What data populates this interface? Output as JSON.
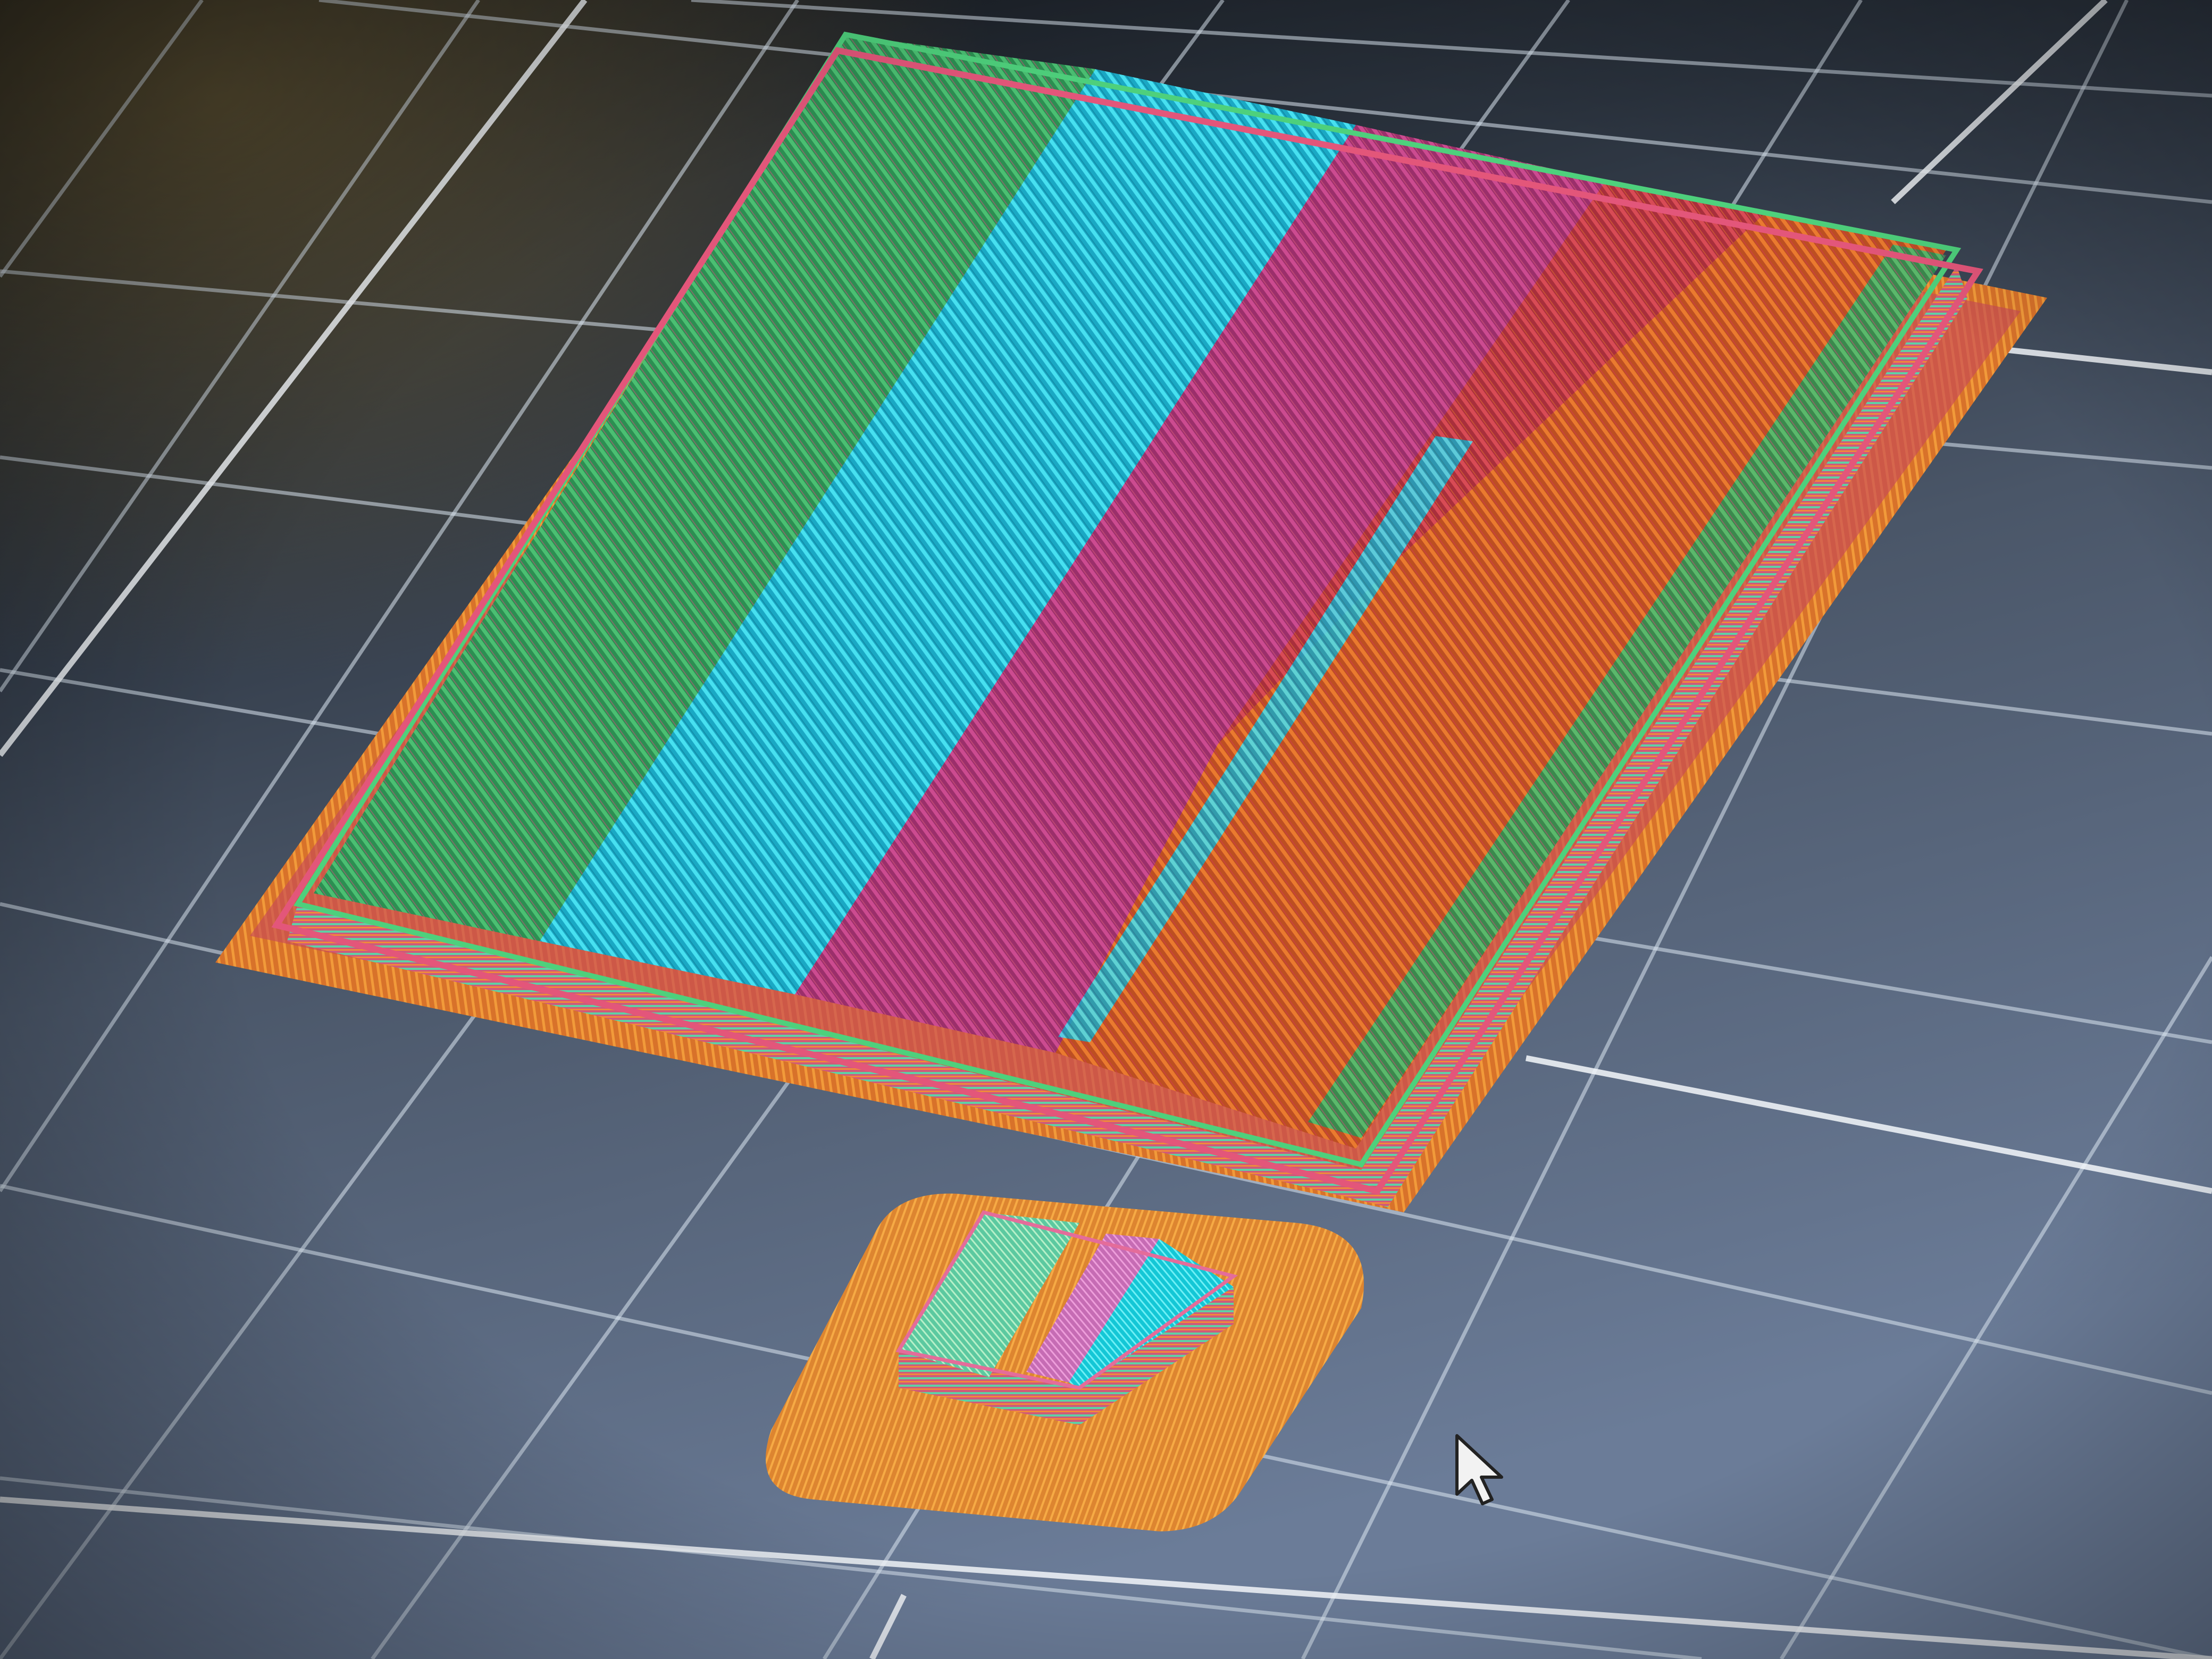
{
  "viewer": {
    "background_top": "#161a1f",
    "background_bottom": "#5d6d86",
    "grid_color": "#d7e2ef",
    "grid_axis_color": "#f4f8fc"
  },
  "objects": [
    {
      "name": "large-plate",
      "brim_color": "#e07a2a",
      "perimeter_colors": [
        "#d24a64",
        "#37b46c",
        "#2fc6df"
      ],
      "regions": [
        {
          "name": "green",
          "color": "#2f9a57"
        },
        {
          "name": "cyan",
          "color": "#27c4dc"
        },
        {
          "name": "magenta",
          "color": "#b23a7b"
        },
        {
          "name": "red",
          "color": "#c4384a"
        },
        {
          "name": "orange",
          "color": "#d36228"
        }
      ]
    },
    {
      "name": "small-part",
      "brim_color": "#e28a2c",
      "regions": [
        {
          "name": "green",
          "color": "#5ad3a4"
        },
        {
          "name": "pink",
          "color": "#d67ac2"
        },
        {
          "name": "cyan",
          "color": "#22d6e1"
        }
      ]
    }
  ],
  "cursor": {
    "icon": "pointer-arrow-icon"
  }
}
